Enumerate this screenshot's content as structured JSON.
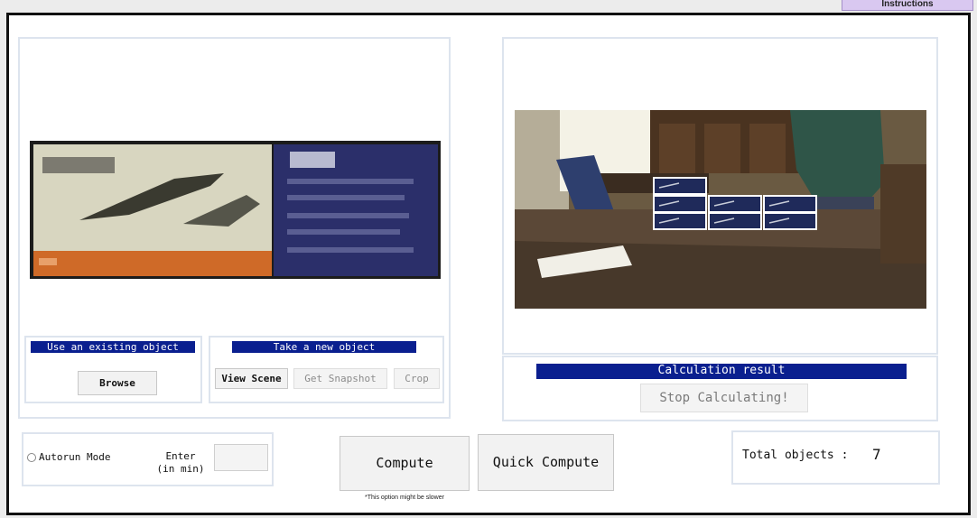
{
  "header": {
    "instructions_label": "Instructions"
  },
  "left_panel": {
    "existing_group": {
      "title": "Use an existing object",
      "browse_label": "Browse"
    },
    "new_group": {
      "title": "Take a new object",
      "view_scene_label": "View Scene",
      "snapshot_label": "Get Snapshot",
      "crop_label": "Crop"
    }
  },
  "right_panel": {
    "result_title": "Calculation result",
    "stop_label": "Stop Calculating!",
    "detected_boxes": 7
  },
  "bottom": {
    "autorun_label": "Autorun Mode",
    "enter_label_1": "Enter",
    "enter_label_2": "(in min)",
    "interval_value": "",
    "compute_label": "Compute",
    "compute_note": "*This option might be slower",
    "quick_compute_label": "Quick Compute",
    "total_label": "Total objects :",
    "total_value": "7"
  },
  "colors": {
    "accent_bar": "#0a1f8f",
    "instructions_bg": "#d9c8f0"
  }
}
